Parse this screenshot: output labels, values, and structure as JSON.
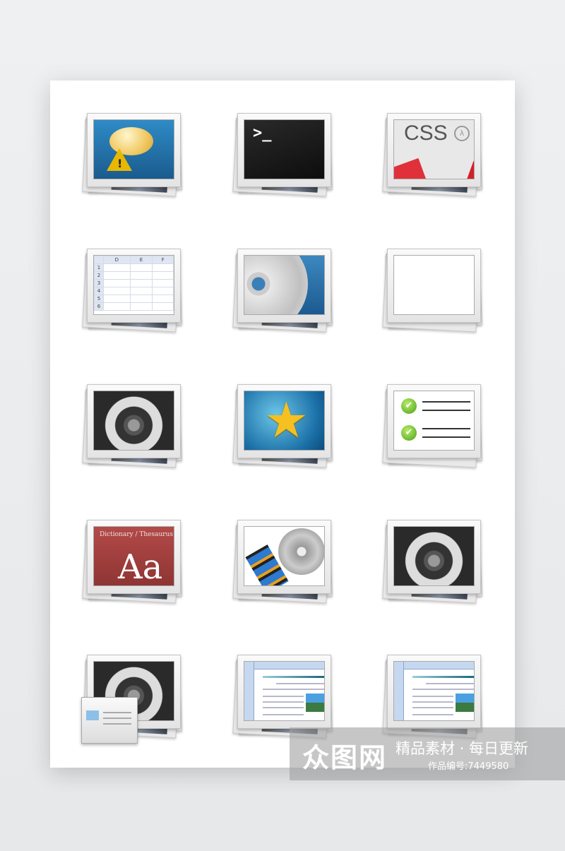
{
  "icons": [
    {
      "name": "alert-message",
      "mark": "!"
    },
    {
      "name": "terminal",
      "prompt": ">_"
    },
    {
      "name": "css",
      "text": "CSS",
      "symbol": "λ"
    },
    {
      "name": "spreadsheet",
      "columns": [
        "D",
        "E",
        "F"
      ],
      "rows": [
        "1",
        "2",
        "3",
        "4",
        "5",
        "6"
      ]
    },
    {
      "name": "cd-disc"
    },
    {
      "name": "blank"
    },
    {
      "name": "gears"
    },
    {
      "name": "favorite-star",
      "glyph": "★"
    },
    {
      "name": "checklist",
      "check": "✔"
    },
    {
      "name": "dictionary",
      "subtitle": "Dictionary / Thesaurus",
      "letters": "Aa"
    },
    {
      "name": "film-reel"
    },
    {
      "name": "gears"
    },
    {
      "name": "gears-window"
    },
    {
      "name": "document"
    },
    {
      "name": "document"
    }
  ],
  "watermark": {
    "logo": "众图网",
    "slogan": "精品素材 · 每日更新",
    "code": "作品编号:7449580"
  },
  "colors": {
    "accent_blue": "#2e8bc6",
    "css_red": "#e0303a",
    "dict_red": "#b24a48",
    "star": "#f5c022",
    "check_green": "#4aa118"
  }
}
